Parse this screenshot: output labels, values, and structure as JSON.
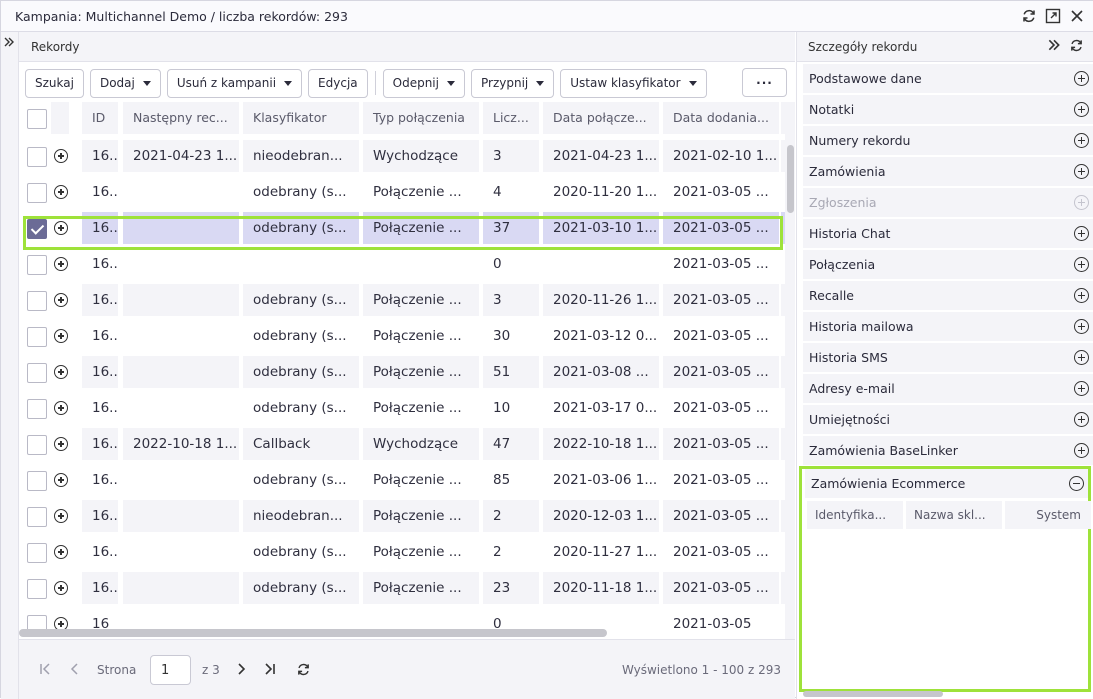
{
  "window": {
    "title": "Kampania: Multichannel Demo / liczba rekordów: 293"
  },
  "records_panel": {
    "title": "Rekordy"
  },
  "toolbar": {
    "search": "Szukaj",
    "add": "Dodaj",
    "remove": "Usuń z kampanii",
    "edit": "Edycja",
    "unpin": "Odepnij",
    "pin": "Przypnij",
    "set_classifier": "Ustaw klasyfikator",
    "more": "···"
  },
  "table": {
    "columns": [
      "ID",
      "Następny rec...",
      "Klasyfikator",
      "Typ połączenia",
      "Licz...",
      "Data połącze...",
      "Data dodania..."
    ],
    "rows": [
      {
        "id": "16...",
        "next": "2021-04-23 1...",
        "classifier": "nieodebran...",
        "type": "Wychodzące",
        "count": "3",
        "call_date": "2021-04-23 1...",
        "added": "2021-02-10 1...",
        "checked": false
      },
      {
        "id": "16...",
        "next": "",
        "classifier": "odebrany (s...",
        "type": "Połączenie ...",
        "count": "4",
        "call_date": "2020-11-20 1...",
        "added": "2021-03-05 ...",
        "checked": false
      },
      {
        "id": "16...",
        "next": "",
        "classifier": "odebrany (s...",
        "type": "Połączenie ...",
        "count": "37",
        "call_date": "2021-03-10 1...",
        "added": "2021-03-05 ...",
        "checked": true
      },
      {
        "id": "16...",
        "next": "",
        "classifier": "",
        "type": "",
        "count": "0",
        "call_date": "",
        "added": "2021-03-05 ...",
        "checked": false
      },
      {
        "id": "16...",
        "next": "",
        "classifier": "odebrany (s...",
        "type": "Połączenie ...",
        "count": "3",
        "call_date": "2020-11-26 1...",
        "added": "2021-03-05 ...",
        "checked": false
      },
      {
        "id": "16...",
        "next": "",
        "classifier": "odebrany (s...",
        "type": "Połączenie ...",
        "count": "30",
        "call_date": "2021-03-12 0...",
        "added": "2021-03-05 ...",
        "checked": false
      },
      {
        "id": "16...",
        "next": "",
        "classifier": "odebrany (s...",
        "type": "Połączenie ...",
        "count": "51",
        "call_date": "2021-03-08 ...",
        "added": "2021-03-05 ...",
        "checked": false
      },
      {
        "id": "16...",
        "next": "",
        "classifier": "odebrany (s...",
        "type": "Połączenie ...",
        "count": "10",
        "call_date": "2021-03-17 0...",
        "added": "2021-03-05 ...",
        "checked": false
      },
      {
        "id": "16...",
        "next": "2022-10-18 1...",
        "classifier": "Callback",
        "type": "Wychodzące",
        "count": "47",
        "call_date": "2022-10-18 1...",
        "added": "2021-03-05 ...",
        "checked": false
      },
      {
        "id": "16...",
        "next": "",
        "classifier": "odebrany (s...",
        "type": "Połączenie ...",
        "count": "85",
        "call_date": "2021-03-06 1...",
        "added": "2021-03-05 ...",
        "checked": false
      },
      {
        "id": "16...",
        "next": "",
        "classifier": "nieodebran...",
        "type": "Połączenie ...",
        "count": "2",
        "call_date": "2020-12-03 1...",
        "added": "2021-03-05 ...",
        "checked": false
      },
      {
        "id": "16...",
        "next": "",
        "classifier": "odebrany (s...",
        "type": "Połączenie ...",
        "count": "2",
        "call_date": "2020-11-27 1...",
        "added": "2021-03-05 ...",
        "checked": false
      },
      {
        "id": "16...",
        "next": "",
        "classifier": "odebrany (s...",
        "type": "Połączenie ...",
        "count": "23",
        "call_date": "2020-11-18 1...",
        "added": "2021-03-05 ...",
        "checked": false
      },
      {
        "id": "16",
        "next": "",
        "classifier": "",
        "type": "",
        "count": "0",
        "call_date": "",
        "added": "2021-03-05",
        "checked": false
      }
    ]
  },
  "pager": {
    "page_label": "Strona",
    "page_value": "1",
    "of_label": "z 3",
    "shown": "Wyświetlono 1 - 100 z 293"
  },
  "details": {
    "title": "Szczegóły rekordu",
    "sections": [
      {
        "label": "Podstawowe dane",
        "enabled": true
      },
      {
        "label": "Notatki",
        "enabled": true
      },
      {
        "label": "Numery rekordu",
        "enabled": true
      },
      {
        "label": "Zamówienia",
        "enabled": true
      },
      {
        "label": "Zgłoszenia",
        "enabled": false
      },
      {
        "label": "Historia Chat",
        "enabled": true
      },
      {
        "label": "Połączenia",
        "enabled": true
      },
      {
        "label": "Recalle",
        "enabled": true
      },
      {
        "label": "Historia mailowa",
        "enabled": true
      },
      {
        "label": "Historia SMS",
        "enabled": true
      },
      {
        "label": "Adresy e-mail",
        "enabled": true
      },
      {
        "label": "Umiejętności",
        "enabled": true
      },
      {
        "label": "Zamówienia BaseLinker",
        "enabled": true
      }
    ],
    "expanded_section": {
      "label": "Zamówienia Ecommerce",
      "columns": [
        "Identyfika...",
        "Nazwa skl...",
        "System"
      ]
    }
  },
  "colors": {
    "highlight": "#9ee23a",
    "selected_row": "#d9d9f3",
    "checkbox_checked": "#6b6b96"
  }
}
